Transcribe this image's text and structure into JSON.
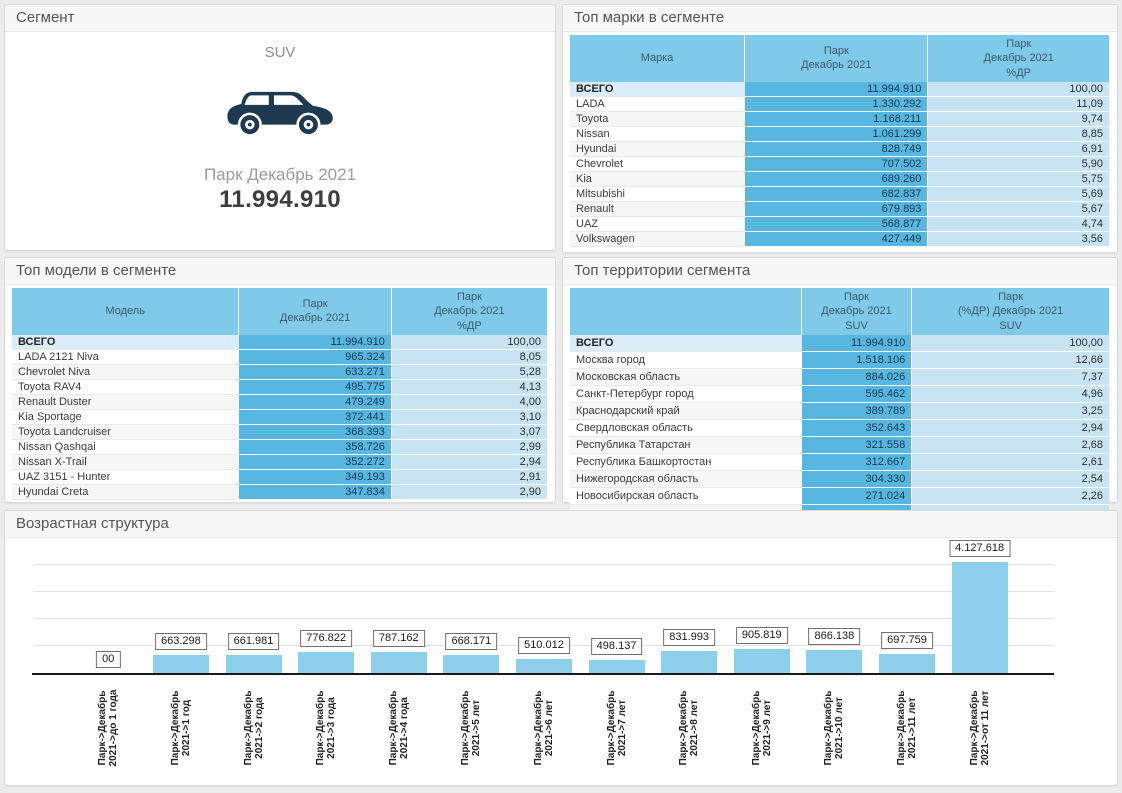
{
  "colors": {
    "page_bg": "#ececec",
    "panel_border": "#d9d9d9",
    "panel_header_bg": "#f7f7f7",
    "panel_title_text": "#545454",
    "table_header_cell": "#7fc9e9",
    "table_header_text": "#3e5a68",
    "table_value_cell": "#58b7e1",
    "table_pct_cell": "#c8e4f3",
    "table_total_cell": "#daecf8",
    "chart_bar": "#8ecfeb",
    "car_icon": "#1d3a50"
  },
  "segment_panel": {
    "title": "Сегмент",
    "segment_name": "SUV",
    "icon": "suv-car-icon",
    "metric_label": "Парк Декабрь 2021",
    "metric_value": "11.994.910"
  },
  "chart_data": [
    {
      "type": "table",
      "title": "Топ марки в сегменте",
      "columns": [
        [
          "Марка"
        ],
        [
          "Парк",
          "Декабрь 2021"
        ],
        [
          "Парк",
          "Декабрь 2021",
          "%ДР"
        ]
      ],
      "col_widths": [
        "32.5%",
        "34%",
        "33.5%"
      ],
      "cut_off": false,
      "rows": [
        {
          "name": "ВСЕГО",
          "park": "11.994.910",
          "share": "100,00",
          "total": true
        },
        {
          "name": "LADA",
          "park": "1.330.292",
          "share": "11,09"
        },
        {
          "name": "Toyota",
          "park": "1.168.211",
          "share": "9,74"
        },
        {
          "name": "Nissan",
          "park": "1.061.299",
          "share": "8,85"
        },
        {
          "name": "Hyundai",
          "park": "828.749",
          "share": "6,91"
        },
        {
          "name": "Chevrolet",
          "park": "707.502",
          "share": "5,90"
        },
        {
          "name": "Kia",
          "park": "689.260",
          "share": "5,75"
        },
        {
          "name": "Mitsubishi",
          "park": "682.837",
          "share": "5,69"
        },
        {
          "name": "Renault",
          "park": "679.893",
          "share": "5,67"
        },
        {
          "name": "UAZ",
          "park": "568.877",
          "share": "4,74"
        },
        {
          "name": "Volkswagen",
          "park": "427.449",
          "share": "3,56"
        }
      ]
    },
    {
      "type": "table",
      "title": "Топ модели в сегменте",
      "columns": [
        [
          "Модель"
        ],
        [
          "Парк",
          "Декабрь 2021"
        ],
        [
          "Парк",
          "Декабрь 2021",
          "%ДР"
        ]
      ],
      "col_widths": [
        "42.5%",
        "28.5%",
        "29%"
      ],
      "cut_off": false,
      "rows": [
        {
          "name": "ВСЕГО",
          "park": "11.994.910",
          "share": "100,00",
          "total": true
        },
        {
          "name": "LADA 2121 Niva",
          "park": "965.324",
          "share": "8,05"
        },
        {
          "name": "Chevrolet Niva",
          "park": "633.271",
          "share": "5,28"
        },
        {
          "name": "Toyota RAV4",
          "park": "495.775",
          "share": "4,13"
        },
        {
          "name": "Renault Duster",
          "park": "479.249",
          "share": "4,00"
        },
        {
          "name": "Kia Sportage",
          "park": "372.441",
          "share": "3,10"
        },
        {
          "name": "Toyota Landcruiser",
          "park": "368.393",
          "share": "3,07"
        },
        {
          "name": "Nissan Qashqai",
          "park": "358.726",
          "share": "2,99"
        },
        {
          "name": "Nissan X-Trail",
          "park": "352.272",
          "share": "2,94"
        },
        {
          "name": "UAZ 3151 - Hunter",
          "park": "349.193",
          "share": "2,91"
        },
        {
          "name": "Hyundai Creta",
          "park": "347.834",
          "share": "2,90"
        }
      ]
    },
    {
      "type": "table",
      "title": "Топ территории сегмента",
      "columns": [
        [
          ""
        ],
        [
          "Парк",
          "Декабрь 2021",
          "SUV"
        ],
        [
          "Парк",
          "(%ДР) Декабрь 2021",
          "SUV"
        ]
      ],
      "col_widths": [
        "43%",
        "20.5%",
        "36.5%"
      ],
      "cut_off": true,
      "rows": [
        {
          "name": "ВСЕГО",
          "park": "11.994.910",
          "share": "100,00",
          "total": true
        },
        {
          "name": "Москва город",
          "park": "1.518.106",
          "share": "12,66"
        },
        {
          "name": "Московская область",
          "park": "884.026",
          "share": "7,37"
        },
        {
          "name": "Санкт-Петербург город",
          "park": "595.462",
          "share": "4,96"
        },
        {
          "name": "Краснодарский край",
          "park": "389.789",
          "share": "3,25"
        },
        {
          "name": "Свердловская область",
          "park": "352.643",
          "share": "2,94"
        },
        {
          "name": "Республика Татарстан",
          "park": "321.558",
          "share": "2,68"
        },
        {
          "name": "Республика Башкортостан",
          "park": "312.667",
          "share": "2,61"
        },
        {
          "name": "Нижегородская область",
          "park": "304.330",
          "share": "2,54"
        },
        {
          "name": "Новосибирская область",
          "park": "271.024",
          "share": "2,26"
        }
      ]
    },
    {
      "type": "bar",
      "title": "Возрастная структура",
      "xlabel": "",
      "ylabel": "",
      "ylim": [
        0,
        4300000
      ],
      "grid": "horizontal",
      "gridlines": [
        1000000,
        2000000,
        3000000,
        4000000
      ],
      "legend": "none",
      "categories": [
        "Парк->Декабрь 2021->до 1 года",
        "Парк->Декабрь 2021->1 год",
        "Парк->Декабрь 2021->2 года",
        "Парк->Декабрь 2021->3 года",
        "Парк->Декабрь 2021->4 года",
        "Парк->Декабрь 2021->5 лет",
        "Парк->Декабрь 2021->6 лет",
        "Парк->Декабрь 2021->7 лет",
        "Парк->Декабрь 2021->8 лет",
        "Парк->Декабрь 2021->9 лет",
        "Парк->Декабрь 2021->10 лет",
        "Парк->Декабрь 2021->11 лет",
        "Парк->Декабрь 2021->от 11 лет"
      ],
      "label_lines": [
        [
          "Парк->Декабрь",
          "2021->до 1 года"
        ],
        [
          "Парк->Декабрь",
          "2021->1 год"
        ],
        [
          "Парк->Декабрь",
          "2021->2 года"
        ],
        [
          "Парк->Декабрь",
          "2021->3 года"
        ],
        [
          "Парк->Декабрь",
          "2021->4 года"
        ],
        [
          "Парк->Декабрь",
          "2021->5 лет"
        ],
        [
          "Парк->Декабрь",
          "2021->6 лет"
        ],
        [
          "Парк->Декабрь",
          "2021->7 лет"
        ],
        [
          "Парк->Декабрь",
          "2021->8 лет"
        ],
        [
          "Парк->Декабрь",
          "2021->9 лет"
        ],
        [
          "Парк->Декабрь",
          "2021->10 лет"
        ],
        [
          "Парк->Декабрь",
          "2021->11 лет"
        ],
        [
          "Парк->Декабрь",
          "2021->от 11 лет"
        ]
      ],
      "values": [
        0,
        663298,
        661981,
        776822,
        787162,
        668171,
        510012,
        498137,
        831993,
        905819,
        866138,
        697759,
        4127618
      ],
      "data_labels": [
        "00",
        "663.298",
        "661.981",
        "776.822",
        "787.162",
        "668.171",
        "510.012",
        "498.137",
        "831.993",
        "905.819",
        "866.138",
        "697.759",
        "4.127.618"
      ]
    }
  ]
}
